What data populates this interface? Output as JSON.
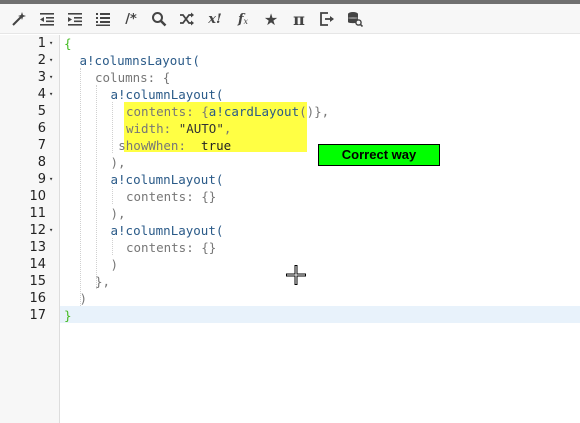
{
  "toolbar": {
    "buttons": [
      {
        "name": "magic-wand-icon",
        "glyph": ""
      },
      {
        "name": "outdent-icon",
        "glyph": ""
      },
      {
        "name": "indent-icon",
        "glyph": ""
      },
      {
        "name": "format-list-icon",
        "glyph": ""
      },
      {
        "name": "comment-icon",
        "glyph": "/*"
      },
      {
        "name": "search-icon",
        "glyph": ""
      },
      {
        "name": "shuffle-icon",
        "glyph": ""
      },
      {
        "name": "expression-icon",
        "glyph": "x!"
      },
      {
        "name": "function-icon",
        "glyph": "f"
      },
      {
        "name": "star-icon",
        "glyph": "★"
      },
      {
        "name": "pi-icon",
        "glyph": "π"
      },
      {
        "name": "export-icon",
        "glyph": ""
      },
      {
        "name": "database-search-icon",
        "glyph": ""
      }
    ]
  },
  "editor": {
    "line_numbers": [
      "1",
      "2",
      "3",
      "4",
      "5",
      "6",
      "7",
      "8",
      "9",
      "10",
      "11",
      "12",
      "13",
      "14",
      "15",
      "16",
      "17"
    ],
    "fold_markers": {
      "1": "▾",
      "2": "▾",
      "3": "▾",
      "4": "▾",
      "9": "▾",
      "12": "▾"
    },
    "lines": [
      {
        "indent": 0,
        "tokens": [
          {
            "t": "{",
            "c": "green"
          }
        ]
      },
      {
        "indent": 1,
        "tokens": [
          {
            "t": "a!columnsLayout(",
            "c": "navy"
          }
        ]
      },
      {
        "indent": 2,
        "tokens": [
          {
            "t": "columns: {",
            "c": "gray"
          }
        ]
      },
      {
        "indent": 3,
        "tokens": [
          {
            "t": "a!columnLayout(",
            "c": "navy"
          }
        ]
      },
      {
        "indent": 4,
        "tokens": [
          {
            "t": "contents: {",
            "c": "gray"
          },
          {
            "t": "a!cardLayout",
            "c": "navy"
          },
          {
            "t": "()},",
            "c": "gray"
          }
        ]
      },
      {
        "indent": 4,
        "tokens": [
          {
            "t": "width: ",
            "c": "gray"
          },
          {
            "t": "\"AUTO\"",
            "c": "str"
          },
          {
            "t": ",",
            "c": "gray"
          }
        ]
      },
      {
        "indent": 3.5,
        "tokens": [
          {
            "t": "showWhen:  ",
            "c": "gray"
          },
          {
            "t": "true",
            "c": "black"
          }
        ]
      },
      {
        "indent": 3,
        "tokens": [
          {
            "t": "),",
            "c": "gray"
          }
        ]
      },
      {
        "indent": 3,
        "tokens": [
          {
            "t": "a!columnLayout(",
            "c": "navy"
          }
        ]
      },
      {
        "indent": 4,
        "tokens": [
          {
            "t": "contents: {}",
            "c": "gray"
          }
        ]
      },
      {
        "indent": 3,
        "tokens": [
          {
            "t": "),",
            "c": "gray"
          }
        ]
      },
      {
        "indent": 3,
        "tokens": [
          {
            "t": "a!columnLayout(",
            "c": "navy"
          }
        ]
      },
      {
        "indent": 4,
        "tokens": [
          {
            "t": "contents: {}",
            "c": "gray"
          }
        ]
      },
      {
        "indent": 3,
        "tokens": [
          {
            "t": ")",
            "c": "gray"
          }
        ]
      },
      {
        "indent": 2,
        "tokens": [
          {
            "t": "},",
            "c": "gray"
          }
        ]
      },
      {
        "indent": 1,
        "tokens": [
          {
            "t": ")",
            "c": "gray"
          }
        ]
      },
      {
        "indent": 0,
        "tokens": [
          {
            "t": "}",
            "c": "green"
          }
        ]
      }
    ]
  },
  "annotation": {
    "label": "Correct way",
    "color": "#00ff00"
  },
  "colors": {
    "highlight": "#ffff44",
    "current_line": "#e8f2fb",
    "brace": "#44bb22",
    "function": "#2a5a88"
  }
}
